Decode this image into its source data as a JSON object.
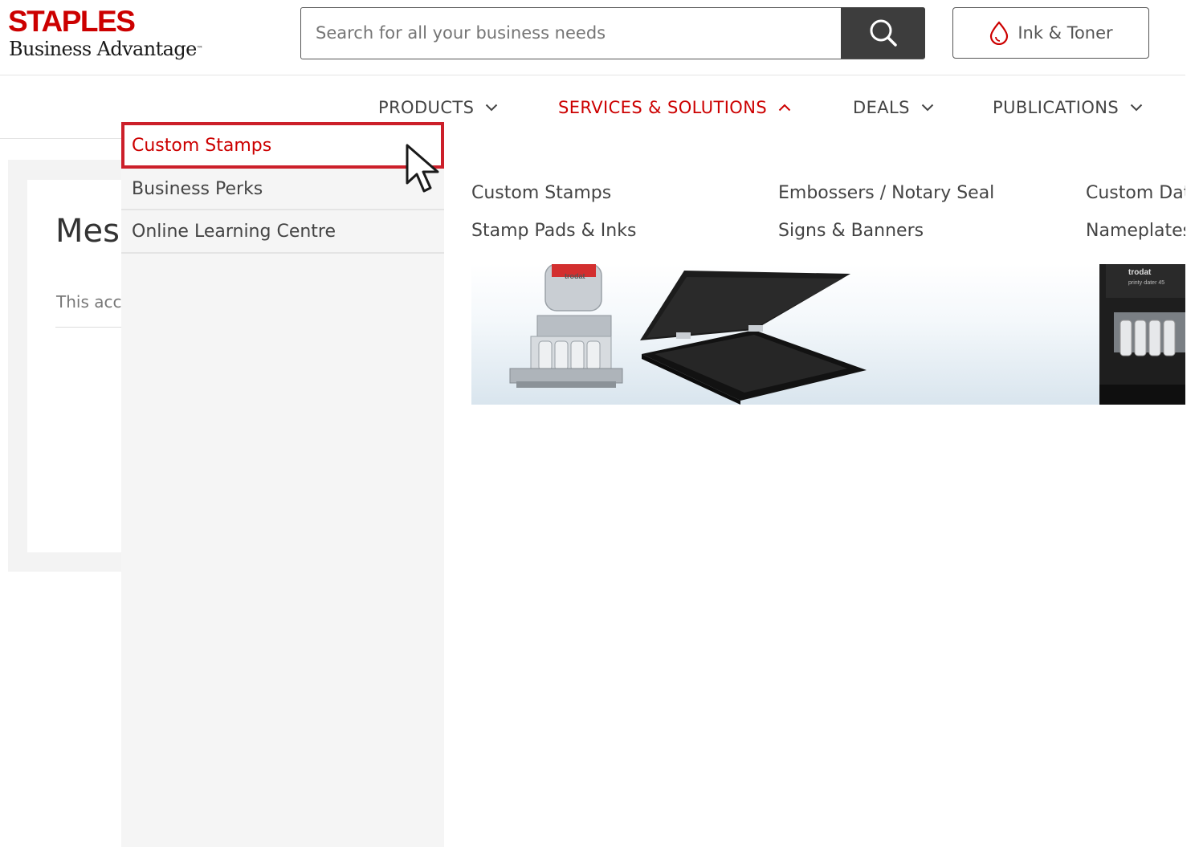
{
  "header": {
    "logo": {
      "brand": "STAPLES",
      "subtitle": "Business Advantage"
    },
    "search": {
      "placeholder": "Search for all your business needs"
    },
    "ink_toner_label": "Ink & Toner"
  },
  "nav": {
    "items": [
      {
        "label": "PRODUCTS",
        "state": "collapsed"
      },
      {
        "label": "SERVICES & SOLUTIONS",
        "state": "expanded"
      },
      {
        "label": "DEALS",
        "state": "collapsed"
      },
      {
        "label": "PUBLICATIONS",
        "state": "collapsed"
      }
    ]
  },
  "background_page": {
    "title": "Mes",
    "text": "This acc"
  },
  "dropdown": {
    "left_items": [
      {
        "label": "Custom Stamps",
        "selected": true
      },
      {
        "label": "Business Perks",
        "selected": false
      },
      {
        "label": "Online Learning Centre",
        "selected": false
      }
    ],
    "sub_links": [
      {
        "label": "Custom Stamps"
      },
      {
        "label": "Stamp Pads & Inks"
      },
      {
        "label": "Embossers / Notary Seal"
      },
      {
        "label": "Signs & Banners"
      },
      {
        "label": "Custom Dat"
      },
      {
        "label": "Nameplates"
      }
    ],
    "banner": {
      "brand_text_1": "trodat",
      "brand_text_2": "trodat",
      "model_text": "printy·dater 45"
    }
  },
  "colors": {
    "brand_red": "#cc0000",
    "selection_outline": "#cc1f2a",
    "search_button": "#3d3d3d",
    "menu_background": "#f5f5f5",
    "text": "#444444"
  },
  "icons": [
    "search-icon",
    "ink-drop-icon",
    "chevron-down-icon",
    "chevron-up-icon",
    "mouse-pointer-icon"
  ]
}
